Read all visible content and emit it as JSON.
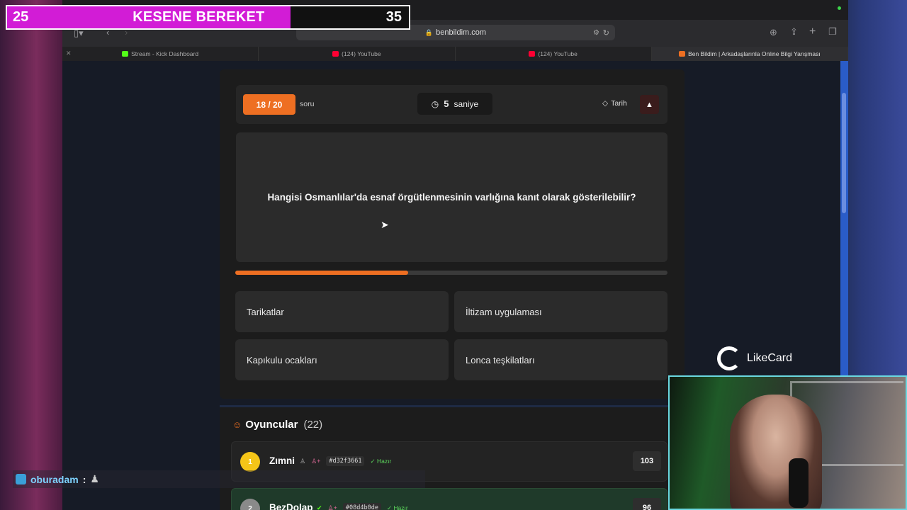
{
  "overlay": {
    "left_value": "25",
    "title": "KESENE BEREKET",
    "right_value": "35"
  },
  "browser": {
    "url": "benbildim.com",
    "tabs": [
      {
        "label": "Stream - Kick Dashboard",
        "favicon_color": "#53fc18"
      },
      {
        "label": "(124) YouTube",
        "favicon_color": "#ff0033"
      },
      {
        "label": "(124) YouTube",
        "favicon_color": "#ff0033"
      },
      {
        "label": "Ben Bildim | Arkadaşlarınla Online Bilgi Yarışması",
        "favicon_color": "#ee6f22"
      }
    ]
  },
  "quiz": {
    "question_counter": "18 / 20",
    "counter_label": "soru",
    "timer_value": "5",
    "timer_unit": "saniye",
    "category": "Tarih",
    "question": "Hangisi Osmanlılar'da esnaf örgütlenmesinin varlığına kanıt olarak gösterilebilir?",
    "progress_fraction": 0.4,
    "answers": [
      "Tarikatlar",
      "İltizam uygulaması",
      "Kapıkulu ocakları",
      "Lonca teşkilatları"
    ]
  },
  "players": {
    "title": "Oyuncular",
    "count": "(22)",
    "rows": [
      {
        "rank": "1",
        "name": "Zımni",
        "hash": "#d32f3661",
        "status": "Hazır",
        "score": "103"
      },
      {
        "rank": "2",
        "name": "BezDolap",
        "hash": "#08d4b0de",
        "status": "Hazır",
        "score": "96"
      }
    ]
  },
  "chat": {
    "user": "oburadam",
    "separator": ":"
  },
  "sponsor": {
    "name": "LikeCard"
  },
  "colors": {
    "accent": "#ee6f22",
    "overlay_fill": "#d21cd6",
    "ready": "#5cd65c",
    "webcam_border": "#6ad8e0"
  }
}
